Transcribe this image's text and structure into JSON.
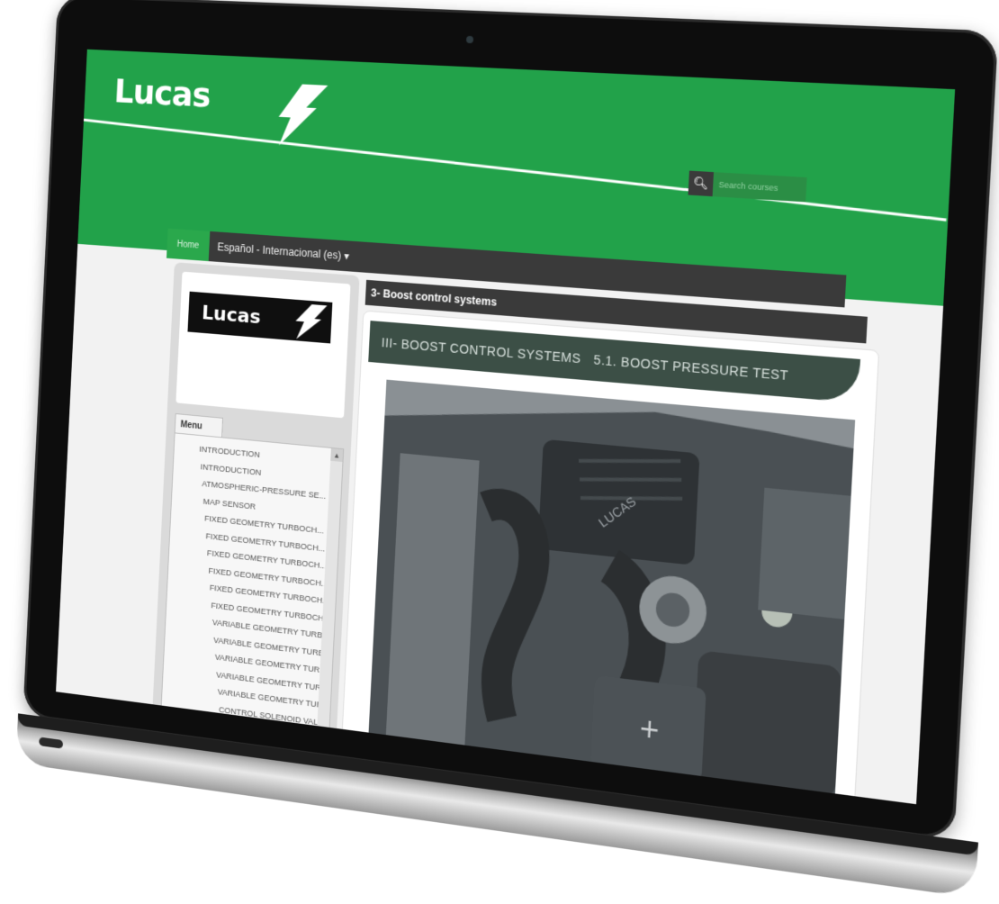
{
  "header": {
    "brand": "Lucas",
    "search_placeholder": "Search courses"
  },
  "nav": {
    "home_label": "Home",
    "language_label": "Español - Internacional (es) ▾"
  },
  "sidebar": {
    "logo_text": "Lucas",
    "menu_tab_label": "Menu",
    "items": [
      {
        "label": "INTRODUCTION"
      },
      {
        "label": "INTRODUCTION"
      },
      {
        "label": "ATMOSPHERIC-PRESSURE SE..."
      },
      {
        "label": "MAP SENSOR"
      },
      {
        "label": "FIXED GEOMETRY TURBOCH..."
      },
      {
        "label": "FIXED GEOMETRY TURBOCH..."
      },
      {
        "label": "FIXED GEOMETRY TURBOCH..."
      },
      {
        "label": "FIXED GEOMETRY TURBOCH..."
      },
      {
        "label": "FIXED GEOMETRY TURBOCH..."
      },
      {
        "label": "FIXED GEOMETRY TURBOCH..."
      },
      {
        "label": "VARIABLE GEOMETRY TURB..."
      },
      {
        "label": "VARIABLE GEOMETRY TURB..."
      },
      {
        "label": "VARIABLE GEOMETRY TURB..."
      },
      {
        "label": "VARIABLE GEOMETRY TURB..."
      },
      {
        "label": "VARIABLE GEOMETRY TURB..."
      },
      {
        "label": "CONTROL SOLENOID VALVE"
      }
    ]
  },
  "content": {
    "breadcrumb": "3- Boost control systems",
    "banner_title": "III- BOOST CONTROL SYSTEMS",
    "banner_subtitle": "5.1. BOOST PRESSURE TEST",
    "photo_label": "LUCAS"
  },
  "colors": {
    "brand_green": "#22a24a",
    "dark_bar": "#3a3a3a",
    "banner": "#3c4f46"
  }
}
